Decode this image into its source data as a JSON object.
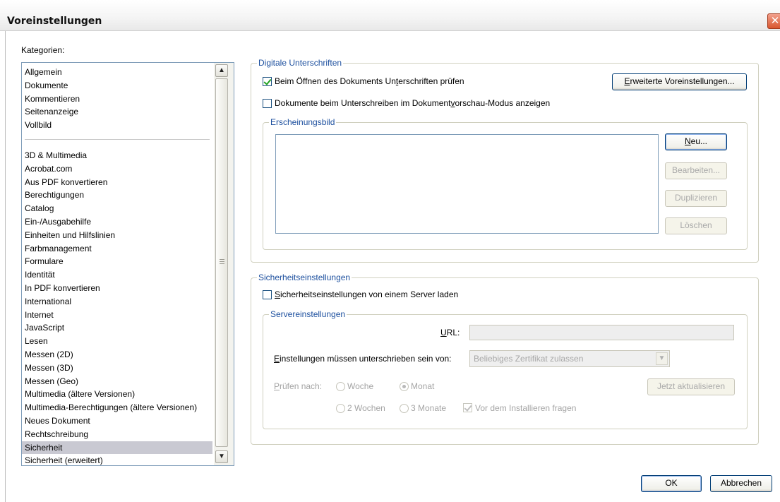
{
  "window": {
    "title": "Voreinstellungen",
    "close_glyph": "✕"
  },
  "categories": {
    "label": "Kategorien:",
    "group1": [
      "Allgemein",
      "Dokumente",
      "Kommentieren",
      "Seitenanzeige",
      "Vollbild"
    ],
    "group2": [
      "3D & Multimedia",
      "Acrobat.com",
      "Aus PDF konvertieren",
      "Berechtigungen",
      "Catalog",
      "Ein-/Ausgabehilfe",
      "Einheiten und Hilfslinien",
      "Farbmanagement",
      "Formulare",
      "Identität",
      "In PDF konvertieren",
      "International",
      "Internet",
      "JavaScript",
      "Lesen",
      "Messen (2D)",
      "Messen (3D)",
      "Messen (Geo)",
      "Multimedia (ältere Versionen)",
      "Multimedia-Berechtigungen (ältere Versionen)",
      "Neues Dokument",
      "Rechtschreibung",
      "Sicherheit",
      "Sicherheit (erweitert)"
    ],
    "selected": "Sicherheit",
    "scroll_up_glyph": "▲",
    "scroll_down_glyph": "▼"
  },
  "digital_signatures": {
    "legend": "Digitale Unterschriften",
    "verify_on_open": {
      "label_pre": "Beim Öffnen des Dokuments Un",
      "label_key": "t",
      "label_post": "erschriften prüfen",
      "checked": true
    },
    "advanced_button": {
      "key": "E",
      "rest": "rweiterte Voreinstellungen..."
    },
    "preview_mode": {
      "label_pre": "Dokumente beim Unterschreiben im Dokument",
      "label_key": "v",
      "label_post": "orschau-Modus anzeigen",
      "checked": false
    },
    "appearance": {
      "legend": "Erscheinungsbild",
      "new_button": {
        "key": "N",
        "rest": "eu..."
      },
      "edit_button": "Bearbeiten...",
      "duplicate_button": "Duplizieren",
      "delete_button": "Löschen"
    }
  },
  "security_settings": {
    "legend": "Sicherheitseinstellungen",
    "load_from_server": {
      "label_key": "S",
      "label_rest": "icherheitseinstellungen von einem Server laden",
      "checked": false
    },
    "server": {
      "legend": "Servereinstellungen",
      "url_label_key": "U",
      "url_label_rest": "RL:",
      "url_value": "",
      "signed_by_label_key": "E",
      "signed_by_label_rest": "instellungen müssen unterschrieben sein von:",
      "signed_by_value": "Beliebiges Zertifikat zulassen",
      "check_label_key": "P",
      "check_label_rest": "rüfen nach:",
      "check_options": [
        "Woche",
        "Monat",
        "2 Wochen",
        "3 Monate"
      ],
      "check_selected": "Monat",
      "ask_before_install": {
        "label": "Vor dem Installieren fragen",
        "checked": true
      },
      "update_now_button": "Jetzt aktualisieren"
    }
  },
  "footer": {
    "ok_label": "OK",
    "cancel_label": "Abbrechen"
  },
  "colors": {
    "legend": "#1c4f9e",
    "selection": "#c9c9d2",
    "close_button": "#d9562f"
  }
}
